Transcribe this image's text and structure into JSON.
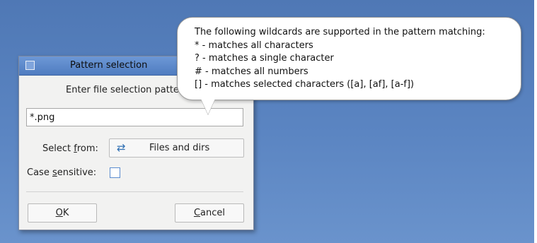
{
  "dialog": {
    "title": "Pattern selection",
    "prompt": "Enter file selection pattern:",
    "pattern_value": "*.png",
    "select_from_label_pre": "Select ",
    "select_from_label_mn": "f",
    "select_from_label_post": "rom:",
    "select_from_value": "Files and dirs",
    "select_from_icon": "swap-arrows-icon",
    "case_label_pre": "Case ",
    "case_label_mn": "s",
    "case_label_post": "ensitive:",
    "case_sensitive_checked": false,
    "ok_mn": "O",
    "ok_post": "K",
    "cancel_mn": "C",
    "cancel_post": "ancel"
  },
  "tooltip": {
    "lines": [
      "The following wildcards are supported in the pattern matching:",
      "* - matches all characters",
      "? - matches a single character",
      "# - matches all numbers",
      "[] - matches selected characters ([a], [af], [a-f])"
    ]
  },
  "colors": {
    "desktop": "#5b85c2",
    "titlebar": "#5a86c8",
    "dialog_bg": "#f2f2f1",
    "checkbox_border": "#5b8ccf"
  }
}
